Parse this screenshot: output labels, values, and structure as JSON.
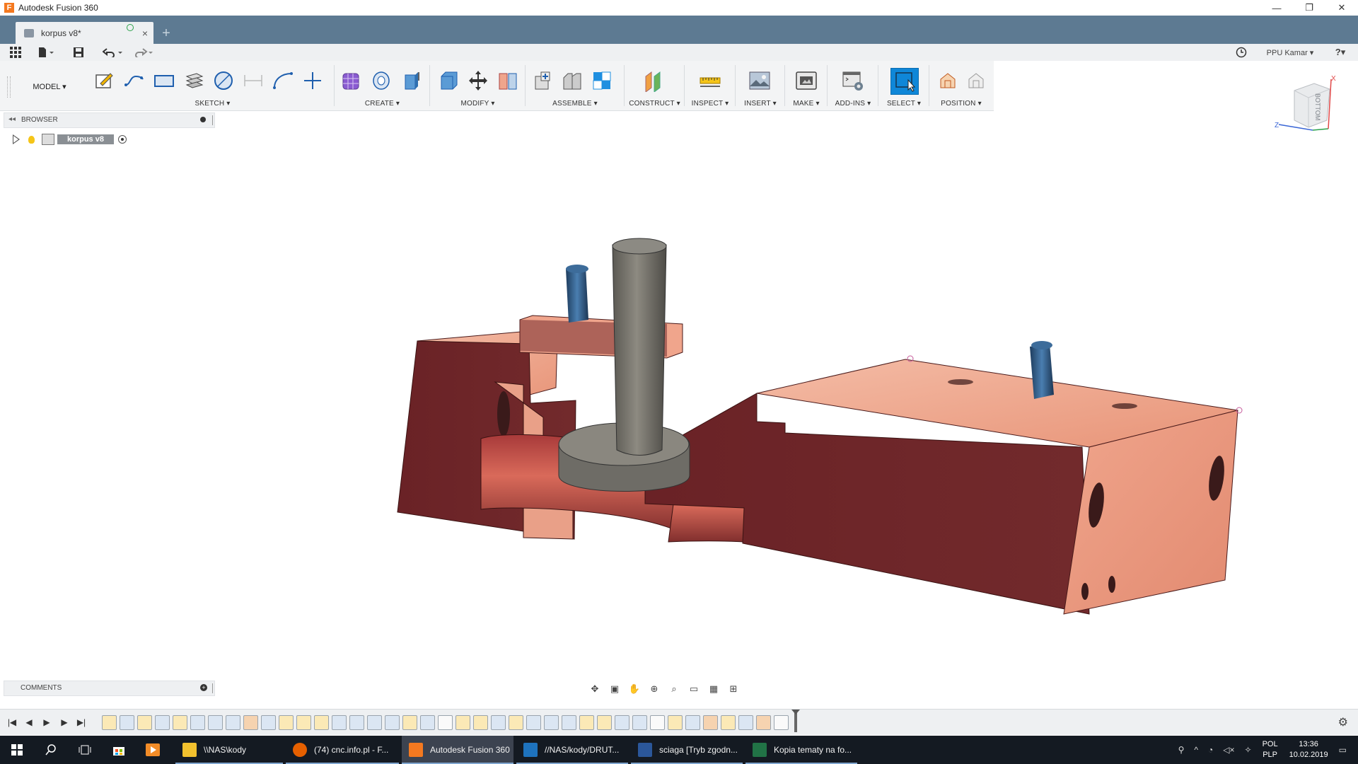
{
  "window": {
    "title": "Autodesk Fusion 360",
    "controls": [
      "—",
      "❐",
      "✕"
    ]
  },
  "tab": {
    "name": "korpus v8*",
    "close": "×",
    "new": "+"
  },
  "quickbar": {
    "user": "PPU Kamar ▾",
    "help": "?▾"
  },
  "toolbar": {
    "workspace": "MODEL ▾",
    "groups": [
      {
        "label": "SKETCH ▾"
      },
      {
        "label": "CREATE ▾"
      },
      {
        "label": "MODIFY ▾"
      },
      {
        "label": "ASSEMBLE ▾"
      },
      {
        "label": "CONSTRUCT ▾"
      },
      {
        "label": "INSPECT ▾"
      },
      {
        "label": "INSERT ▾"
      },
      {
        "label": "MAKE ▾"
      },
      {
        "label": "ADD-INS ▾"
      },
      {
        "label": "SELECT ▾"
      },
      {
        "label": "POSITION ▾"
      }
    ]
  },
  "browser": {
    "title": "BROWSER",
    "root_component": "korpus v8"
  },
  "viewcube": {
    "face": "BOTTOM",
    "axis_x": "X",
    "axis_z": "Z"
  },
  "comments": {
    "title": "COMMENTS"
  },
  "taskbar": {
    "apps": [
      {
        "label": "\\\\NAS\\kody",
        "color": "#f2c12e"
      },
      {
        "label": "(74) cnc.info.pl - F...",
        "color": "#e66000"
      },
      {
        "label": "Autodesk Fusion 360",
        "color": "#f47920"
      },
      {
        "label": "//NAS/kody/DRUT...",
        "color": "#1e73be"
      },
      {
        "label": "sciaga  [Tryb zgodn...",
        "color": "#2b579a"
      },
      {
        "label": "Kopia tematy na fo...",
        "color": "#217346"
      }
    ],
    "language": "POL",
    "layout": "PLP",
    "time": "13:36",
    "date": "10.02.2019"
  },
  "colors": {
    "tabbar": "#5d7a92",
    "model_dark": "#6b2529",
    "model_light": "#f0a58c",
    "shaft": "#7d7a72",
    "pin": "#2f5b86",
    "select_active": "#0f87d8"
  }
}
